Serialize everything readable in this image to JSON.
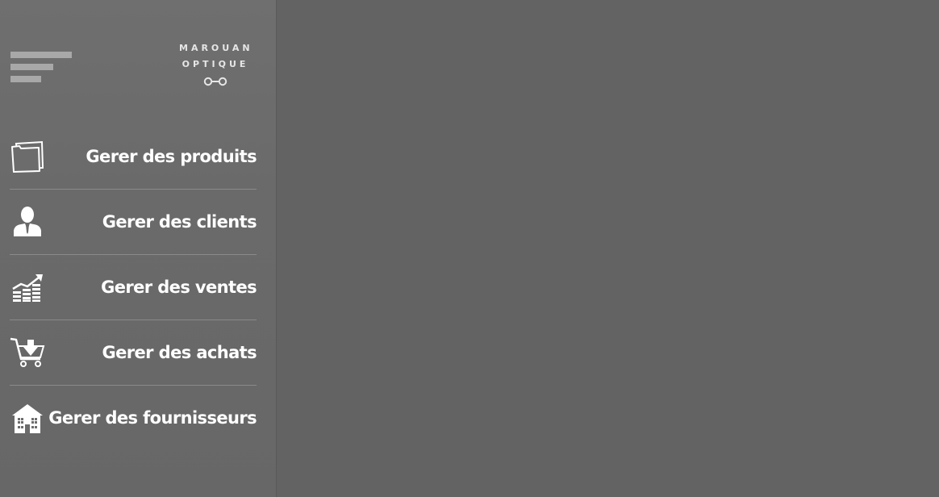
{
  "brand": {
    "line1": "MAROUAN",
    "line2": "OPTIQUE",
    "logo_icon": "glasses-icon"
  },
  "menu_toggle": {
    "icon": "hamburger-menu-icon"
  },
  "sidebar": {
    "items": [
      {
        "label": "Gerer des produits",
        "icon": "folder-icon"
      },
      {
        "label": "Gerer des clients",
        "icon": "person-icon"
      },
      {
        "label": "Gerer des ventes",
        "icon": "sales-chart-icon"
      },
      {
        "label": "Gerer des achats",
        "icon": "shopping-cart-icon"
      },
      {
        "label": "Gerer des fournisseurs",
        "icon": "building-icon"
      }
    ]
  },
  "colors": {
    "sidebar_bg": "#6a6a6a",
    "main_bg": "#636363",
    "text": "#ffffff",
    "divider": "#8a8a8a",
    "toggle_bars": "#a8a8a8"
  }
}
